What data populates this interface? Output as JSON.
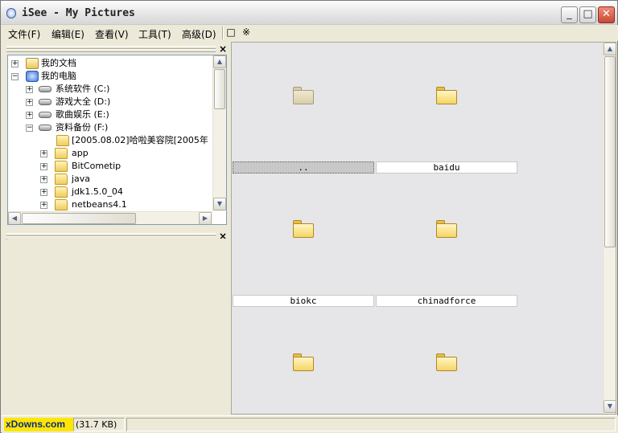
{
  "window": {
    "title": "iSee - My Pictures"
  },
  "title_buttons": {
    "minimize": "_",
    "maximize": "□",
    "close": "✕"
  },
  "menu": {
    "items": [
      {
        "label": "文件(F)"
      },
      {
        "label": "编辑(E)"
      },
      {
        "label": "查看(V)"
      },
      {
        "label": "工具(T)"
      },
      {
        "label": "高级(D)"
      }
    ],
    "tool_a": "□",
    "tool_b": "※"
  },
  "panes": {
    "close_glyph": "×"
  },
  "tree": {
    "items": [
      {
        "label": "我的文档",
        "icon": "documents-icon",
        "expander": "+"
      },
      {
        "label": "我的电脑",
        "icon": "computer-icon",
        "expander": "−"
      },
      {
        "label": "系统软件 (C:)",
        "icon": "drive-icon",
        "expander": "+"
      },
      {
        "label": "游戏大全 (D:)",
        "icon": "drive-icon",
        "expander": "+"
      },
      {
        "label": "歌曲娱乐 (E:)",
        "icon": "drive-icon",
        "expander": "+"
      },
      {
        "label": "资料备份 (F:)",
        "icon": "drive-icon",
        "expander": "−"
      },
      {
        "label": "[2005.08.02]哈啦美容院[2005年",
        "icon": "folder-icon",
        "expander": ""
      },
      {
        "label": "app",
        "icon": "folder-icon",
        "expander": "+"
      },
      {
        "label": "BitCometip",
        "icon": "folder-icon",
        "expander": "+"
      },
      {
        "label": "java",
        "icon": "folder-icon",
        "expander": "+"
      },
      {
        "label": "jdk1.5.0_04",
        "icon": "folder-icon",
        "expander": "+"
      },
      {
        "label": "netbeans4.1",
        "icon": "folder-icon",
        "expander": "+"
      }
    ]
  },
  "thumbnails": [
    {
      "label": "..",
      "icon": "parent-folder-icon",
      "selected": true
    },
    {
      "label": "baidu",
      "icon": "folder-icon",
      "selected": false
    },
    {
      "label": "biokc",
      "icon": "folder-icon",
      "selected": false
    },
    {
      "label": "chinadforce",
      "icon": "folder-icon",
      "selected": false
    },
    {
      "label": "",
      "icon": "folder-icon",
      "selected": false
    },
    {
      "label": "",
      "icon": "folder-icon",
      "selected": false
    }
  ],
  "status": {
    "logo": "xDowns.com",
    "size": "(31.7 KB)",
    "message": ""
  }
}
